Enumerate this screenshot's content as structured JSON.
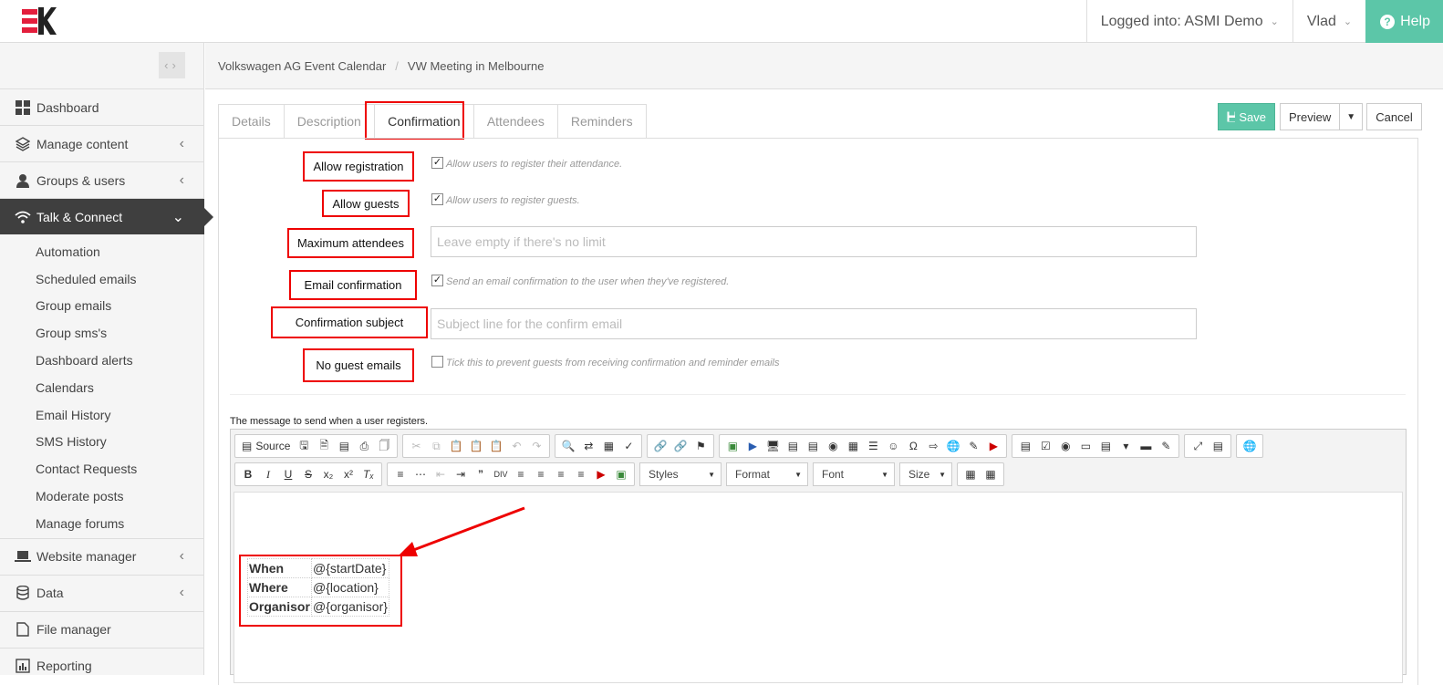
{
  "header": {
    "logged_into": "Logged into: ASMI Demo",
    "user": "Vlad",
    "help": "Help",
    "brand_colors": {
      "accent": "#5cc6a8",
      "logo_red": "#e31e3c",
      "logo_dark": "#222222"
    }
  },
  "sidebar": {
    "items": [
      {
        "label": "Dashboard",
        "icon": "grid-icon"
      },
      {
        "label": "Manage content",
        "icon": "layers-icon"
      },
      {
        "label": "Groups & users",
        "icon": "user-icon"
      },
      {
        "label": "Talk & Connect",
        "icon": "wifi-icon",
        "active": true
      },
      {
        "label": "Website manager",
        "icon": "laptop-icon"
      },
      {
        "label": "Data",
        "icon": "database-icon"
      },
      {
        "label": "File manager",
        "icon": "file-icon"
      },
      {
        "label": "Reporting",
        "icon": "bar-chart-icon"
      }
    ],
    "sub_items": [
      "Automation",
      "Scheduled emails",
      "Group emails",
      "Group sms's",
      "Dashboard alerts",
      "Calendars",
      "Email History",
      "SMS History",
      "Contact Requests",
      "Moderate posts",
      "Manage forums"
    ]
  },
  "breadcrumb": [
    "Volkswagen AG Event Calendar",
    "VW Meeting in Melbourne"
  ],
  "tabs": [
    "Details",
    "Description",
    "Confirmation",
    "Attendees",
    "Reminders"
  ],
  "active_tab": "Confirmation",
  "actions": {
    "save": "Save",
    "preview": "Preview",
    "cancel": "Cancel"
  },
  "form": {
    "allow_registration": {
      "label": "Allow registration",
      "help": "Allow users to register their attendance.",
      "checked": true
    },
    "allow_guests": {
      "label": "Allow guests",
      "help": "Allow users to register guests.",
      "checked": true
    },
    "max_attendees": {
      "label": "Maximum attendees",
      "placeholder": "Leave empty if there's no limit"
    },
    "email_confirmation": {
      "label": "Email confirmation",
      "help": "Send an email confirmation to the user when they've registered.",
      "checked": true
    },
    "confirmation_subject": {
      "label": "Confirmation subject",
      "placeholder": "Subject line for the confirm email"
    },
    "no_guest_emails": {
      "label": "No guest emails",
      "help": "Tick this to prevent guests from receiving confirmation and reminder emails",
      "checked": false
    }
  },
  "editor": {
    "label": "The message to send when a user registers.",
    "source": "Source",
    "combos": [
      "Styles",
      "Format",
      "Font",
      "Size"
    ],
    "table": [
      {
        "key": "When",
        "value": "@{startDate}"
      },
      {
        "key": "Where",
        "value": "@{location}"
      },
      {
        "key": "Organisor",
        "value": "@{organisor}"
      }
    ]
  }
}
